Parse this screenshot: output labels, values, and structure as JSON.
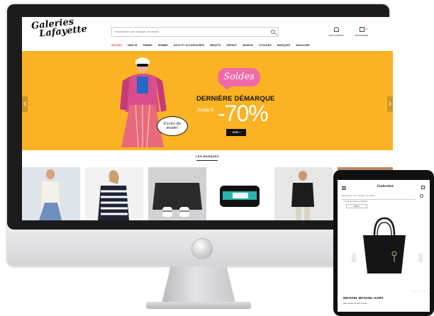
{
  "site": {
    "logo_line1": "Galeries",
    "logo_line2": "Lafayette",
    "search_placeholder": "Rechercher une marque, un article...",
    "account_label": "MON COMPTE",
    "bag_label": "MON PANIER",
    "bag_count": "00"
  },
  "nav": {
    "items": [
      "SOLDES",
      "NEW IN",
      "FEMME",
      "HOMME",
      "SACS ET ACCESSOIRES",
      "BEAUTE",
      "ENFANT",
      "MAISON",
      "VOYAGES",
      "MARQUES",
      "MAGAZINE"
    ]
  },
  "hero": {
    "badge": "Soldes",
    "title": "DERNIÈRE DÉMARQUE",
    "prefix": "Jusqu'à",
    "percent": "-70%",
    "bubble_line1": "Excès de",
    "bubble_line2": "mode!",
    "cta": "VITE !"
  },
  "brands": {
    "label": "LES MARQUES"
  },
  "tablet": {
    "search_placeholder": "Rechercher une marque, un article...",
    "back_label": "< Tous les sacs et articles",
    "filter_label": "Filtrer",
    "dots": "• • • • •",
    "product_brand": "MICHAEL MICHAEL KORS",
    "product_name": "Sac cabas Jet Set Travel"
  },
  "colors": {
    "hero_background": "#fbb324",
    "soldes_pink": "#f06aa8",
    "sale_red": "#e53935"
  }
}
